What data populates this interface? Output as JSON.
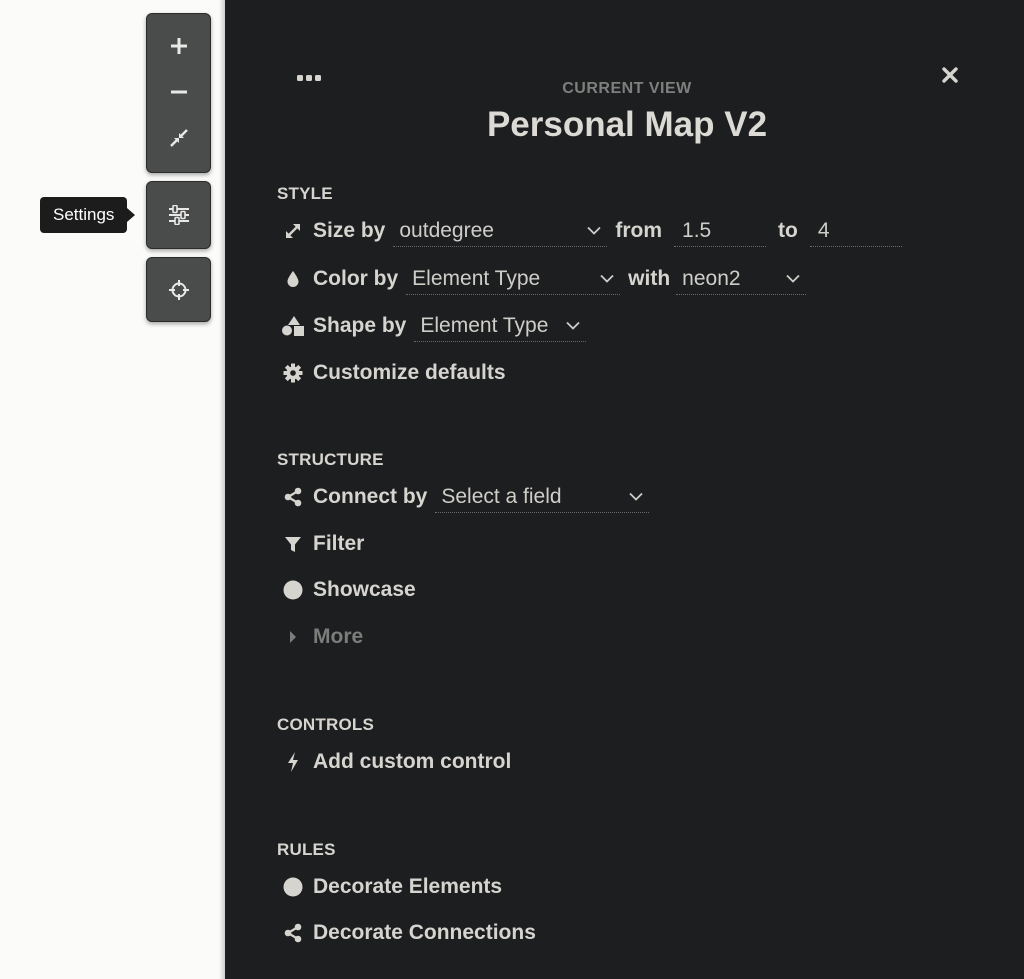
{
  "toolbar": {
    "tooltip": "Settings"
  },
  "panel": {
    "view_label": "CURRENT VIEW",
    "title": "Personal Map V2",
    "style": {
      "heading": "STYLE",
      "size_by": {
        "label": "Size by",
        "field": "outdegree",
        "from_label": "from",
        "from_value": "1.5",
        "to_label": "to",
        "to_value": "4"
      },
      "color_by": {
        "label": "Color by",
        "field": "Element Type",
        "with_label": "with",
        "palette": "neon2"
      },
      "shape_by": {
        "label": "Shape by",
        "field": "Element Type"
      },
      "customize": "Customize defaults"
    },
    "structure": {
      "heading": "STRUCTURE",
      "connect_by": {
        "label": "Connect by",
        "placeholder": "Select a field"
      },
      "filter": "Filter",
      "showcase": "Showcase",
      "more": "More"
    },
    "controls": {
      "heading": "CONTROLS",
      "add": "Add custom control"
    },
    "rules": {
      "heading": "RULES",
      "decorate_elements": "Decorate Elements",
      "decorate_connections": "Decorate Connections"
    }
  },
  "colors": {
    "panel_bg": "#1d1e20",
    "text": "#d6d4cf",
    "muted": "#7c7c7b",
    "toolbar_bg": "#4a4b4b"
  },
  "icons": [
    "plus-icon",
    "minus-icon",
    "collapse-arrows-icon",
    "sliders-icon",
    "crosshair-icon",
    "ellipsis-icon",
    "close-icon",
    "resize-arrows-icon",
    "droplet-icon",
    "shapes-icon",
    "gear-icon",
    "share-icon",
    "funnel-icon",
    "circle-icon",
    "caret-right-icon",
    "bolt-icon",
    "chevron-down-icon"
  ]
}
